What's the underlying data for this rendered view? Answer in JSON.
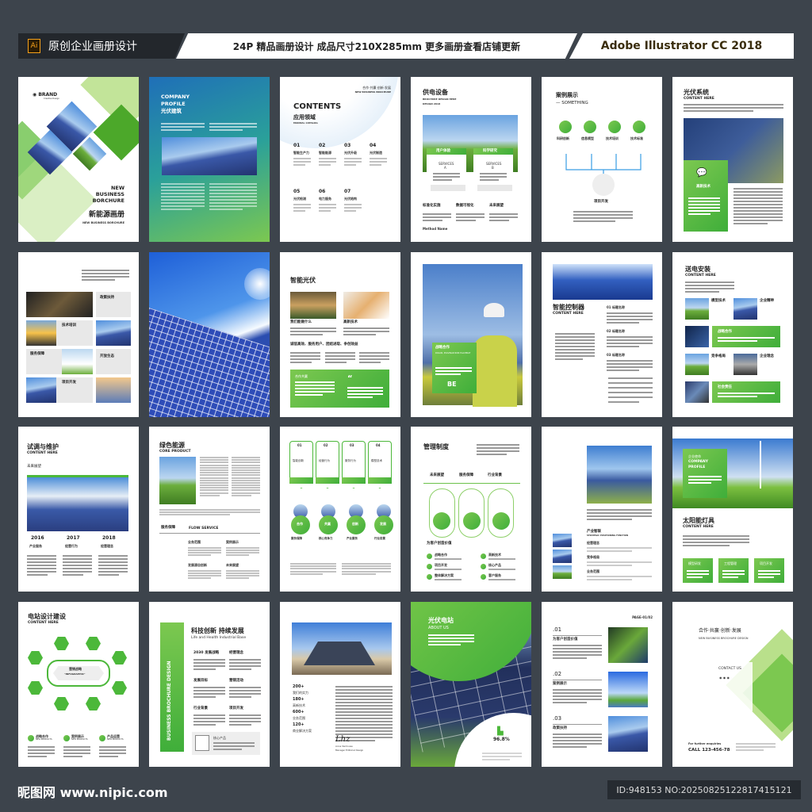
{
  "header": {
    "ai_badge": "Ai",
    "left_title": "原创企业画册设计",
    "center_text": "24P 精品画册设计 成品尺寸210X285mm 更多画册查看店铺更新",
    "right_text": "Adobe Illustrator CC 2018"
  },
  "footer": {
    "watermark": "昵图网 www.nipic.com",
    "id_text": "ID:948153 NO:20250825122817415121"
  },
  "colors": {
    "background": "#3d444c",
    "green": "#5cb83a",
    "panel_blue": "#2a3f8a"
  },
  "pages": {
    "p1": {
      "brand": "BRAND",
      "brand_sub": "Creative Design",
      "title1": "NEW",
      "title2": "BUSINESS",
      "title3": "BORCHURE",
      "cn_title": "新能源画册",
      "en_sub": "NEW BUSINESS BORCHURE"
    },
    "p2": {
      "title1": "COMPANY",
      "title2": "PROFILE",
      "cn": "光伏建筑"
    },
    "p3": {
      "motto": "合作·共赢·创新·发展",
      "motto_en": "NEW BUSINESS BROCHURE",
      "title": "CONTENTS",
      "cn": "应用领域",
      "en": "MANUAL CATALOG",
      "items": [
        {
          "n": "01",
          "t": "智能生产力"
        },
        {
          "n": "02",
          "t": "智能能源"
        },
        {
          "n": "03",
          "t": "光伏升级"
        },
        {
          "n": "04",
          "t": "光伏制造"
        },
        {
          "n": "05",
          "t": "光伏检测"
        },
        {
          "n": "06",
          "t": "电力服务"
        },
        {
          "n": "07",
          "t": "光伏结构"
        }
      ]
    },
    "p4": {
      "title": "供电设备",
      "sub": "BROCHURE DESIGN HERE",
      "sub2": "DESIGN 2018",
      "tab1": "用户体验",
      "tab2": "科学研究",
      "svc1": "SERVICES",
      "svc1b": "A",
      "svc2": "SERVICES",
      "svc2b": "B",
      "col1": "标准化实施",
      "col2": "数据可视化",
      "col3": "未来展望",
      "method": "Method Name"
    },
    "p5": {
      "title": "案例展示",
      "sub": "— SOMETHING",
      "icons": [
        "科研创新",
        "信息模型",
        "技术培训",
        "技术标准"
      ],
      "center": "项目开发"
    },
    "p6": {
      "title": "光伏系统",
      "sub": "CONTENT HERE",
      "box": "高新技术"
    },
    "p7": {
      "items": [
        "政策扶持",
        "技术培训",
        "服务保障",
        "开放生态",
        "项目开发"
      ]
    },
    "p9": {
      "title": "智能光伏",
      "c1": "我们能做什么",
      "c2": "高新技术",
      "slogan": "诚信高效、服务用户、团结进取、争创效益",
      "box": "合作共赢",
      "quote": "“"
    },
    "p10": {
      "box_title": "战略合作",
      "box_sub": "DOLOR, PULVINAR NON PLACERAT",
      "be": "BE"
    },
    "p11": {
      "title": "智能控制器",
      "sub": "CONTENT HERE",
      "items": [
        "01 标题名称",
        "02 标题名称",
        "03 标题名称"
      ]
    },
    "p12": {
      "title": "送电安装",
      "sub": "CONTENT HERE",
      "items": [
        "模型技术",
        "企业精神",
        "战略合作",
        "竞争格局",
        "企业理念",
        "社会责任"
      ]
    },
    "p13": {
      "title": "试调与维护",
      "sub": "CONTENT HERE",
      "label": "未来展望",
      "years": [
        {
          "y": "2016",
          "t": "产业服务"
        },
        {
          "y": "2017",
          "t": "经营行为"
        },
        {
          "y": "2018",
          "t": "经营理念"
        }
      ]
    },
    "p14": {
      "title": "绿色能源",
      "sub": "CORE PRODUCT",
      "sec": "服务保障",
      "sec_en": "FLOW SERVICE",
      "items": [
        "业务范围",
        "案例展示",
        "发展源自创新",
        "未来展望"
      ]
    },
    "p15": {
      "cards": [
        {
          "n": "01",
          "t": "智能创新"
        },
        {
          "n": "02",
          "t": "经营行为"
        },
        {
          "n": "03",
          "t": "服务行为"
        },
        {
          "n": "04",
          "t": "模型技术"
        }
      ],
      "circles": [
        "合作",
        "共赢",
        "创新",
        "发展"
      ],
      "labels": [
        "服务保障",
        "核心竞争力",
        "产业服务",
        "行业前景"
      ]
    },
    "p16": {
      "title": "管理制度",
      "heads": [
        "未来展望",
        "服务保障",
        "行业背景"
      ],
      "sec": "为客户创造价值",
      "items": [
        "战略合作",
        "高新技术",
        "项目开发",
        "核心产品",
        "整体解决方案",
        "客户服务"
      ]
    },
    "p17": {
      "title": "产业智联",
      "sub": "STRATEGIC POSITIONING FUNCTION",
      "rows": [
        "经营理念",
        "竞争格局",
        "业务范围"
      ]
    },
    "p18": {
      "box1": "企业使命",
      "box2": "COMPANY",
      "box3": "PROFILE",
      "title": "太阳能灯具",
      "sub": "CONTENT HERE",
      "boxes": [
        "模型研发",
        "工程管理",
        "项目开发"
      ]
    },
    "p19": {
      "title": "电站设计建设",
      "sub": "CONTENT HERE",
      "center": "营销战略",
      "center_en": "\"INFOGRAPHIC\"",
      "items": [
        "战略合作",
        "案例展示",
        "产品运营"
      ],
      "items_en": "NEW PRODUCTS"
    },
    "p20": {
      "vertical": "BUSINESS BROCHURE DESIGN",
      "title": "科技创新 持续发展",
      "sub": "Life and Health Industrial Base",
      "items": [
        "2030 发展战略",
        "经营理念",
        "发展目标",
        "营销活动",
        "行业背景",
        "项目开发"
      ],
      "core": "核心产品"
    },
    "p21": {
      "stats": [
        {
          "v": "200+",
          "t": "我们的实力"
        },
        {
          "v": "180+",
          "t": "高新技术"
        },
        {
          "v": "600+",
          "t": "业务范围"
        },
        {
          "v": "120+",
          "t": "商业解决方案"
        }
      ],
      "sign": "Lhz",
      "sign_name": "Anna Vanhouse",
      "sign_role": "Manager Editorial Design"
    },
    "p22": {
      "title": "光伏电站",
      "sub": "ABOUT US",
      "percent": "96.8%"
    },
    "p23": {
      "page": "PAGE-01/02",
      "items": [
        {
          "n": ".01",
          "t": "为客户创造价值"
        },
        {
          "n": ".02",
          "t": "案例展示"
        },
        {
          "n": ".03",
          "t": "政策扶持"
        }
      ]
    },
    "p24": {
      "motto": "合作·共赢·创新·发展",
      "motto_en": "NEW BUSINESS BROCHURE DESIGN",
      "contact": "CONTACT US",
      "enq": "For further enquiries",
      "call": "CALL 123-456-78"
    }
  }
}
